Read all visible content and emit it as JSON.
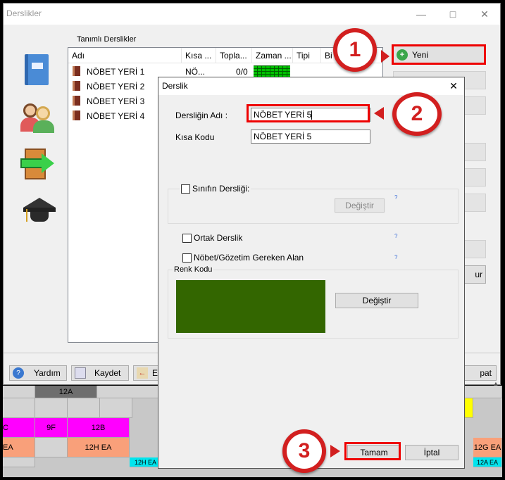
{
  "window": {
    "title": "Derslikler"
  },
  "list": {
    "group_label": "Tanımlı Derslikler",
    "columns": [
      "Adı",
      "Kısa ...",
      "Topla...",
      "Zaman ...",
      "Tipi",
      "Bi"
    ],
    "rows": [
      {
        "name": "NÖBET YERİ 1",
        "short": "NÖ...",
        "total": "0/0"
      },
      {
        "name": "NÖBET YERİ 2"
      },
      {
        "name": "NÖBET YERİ 3"
      },
      {
        "name": "NÖBET YERİ 4"
      }
    ]
  },
  "right_buttons": {
    "new_label": "Yeni",
    "partial_label": "ur"
  },
  "bottom": {
    "help_label": "Yardım",
    "save_label": "Kaydet",
    "partial1": "E",
    "close_partial": "pat"
  },
  "grid": {
    "header": "12A",
    "cells": [
      "C",
      "9F",
      "12B",
      "EA",
      "12H EA",
      "12G EA",
      "12H EA",
      "12A EA"
    ]
  },
  "dialog": {
    "title": "Derslik",
    "name_label": "Dersliğin Adı :",
    "name_value": "NÖBET YERİ 5",
    "short_label": "Kısa Kodu",
    "short_value": "NÖBET YERİ 5",
    "class_room_label": "Sınıfın Dersliği:",
    "change_label": "Değiştir",
    "shared_label": "Ortak Derslik",
    "duty_label": "Nöbet/Gözetim Gereken Alan",
    "color_group_label": "Renk Kodu",
    "color_change_label": "Değiştir",
    "ok_label": "Tamam",
    "cancel_label": "İptal",
    "help_mark": "?"
  },
  "colors": {
    "room_color": "#336600",
    "magenta": "#ff00ff",
    "salmon": "#f9a07a",
    "cyan": "#00e5ee",
    "yellow": "#ffff00",
    "callout": "#d21f1f"
  },
  "callouts": [
    "1",
    "2",
    "3"
  ]
}
